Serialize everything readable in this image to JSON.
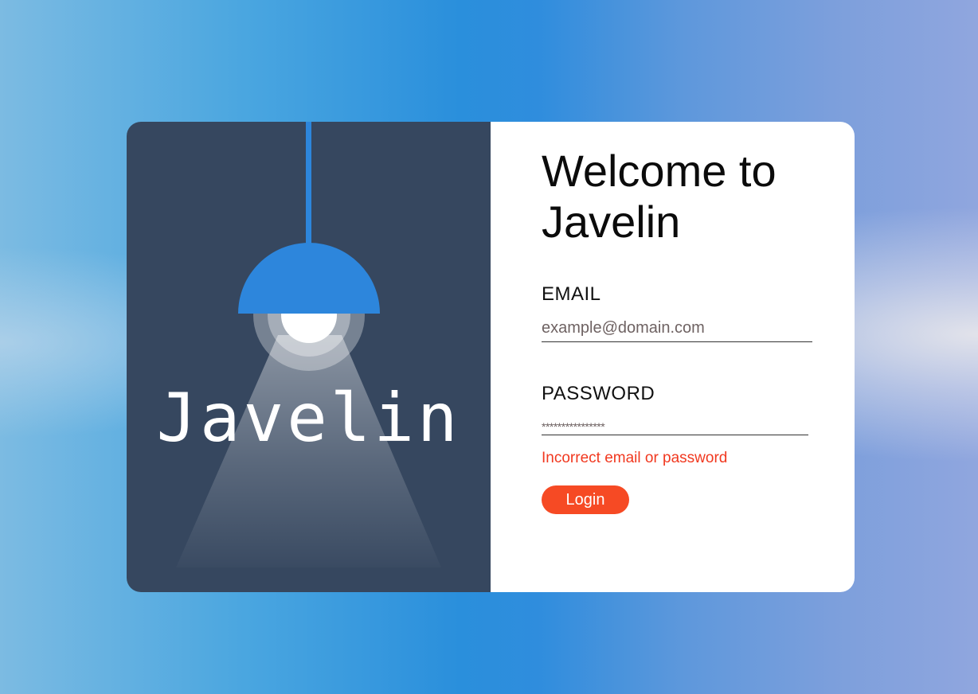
{
  "brand": {
    "name": "Javelin",
    "illustration": "ceiling-lamp-icon",
    "panel_color": "#36475f",
    "lamp_color": "#2d86dc"
  },
  "login": {
    "title": "Welcome to Javelin",
    "email": {
      "label": "EMAIL",
      "placeholder": "example@domain.com",
      "value": ""
    },
    "password": {
      "label": "PASSWORD",
      "masked_value": "****************"
    },
    "error": "Incorrect email or password",
    "login_label": "Login"
  },
  "colors": {
    "accent": "#f64a24",
    "error": "#f1381f"
  }
}
